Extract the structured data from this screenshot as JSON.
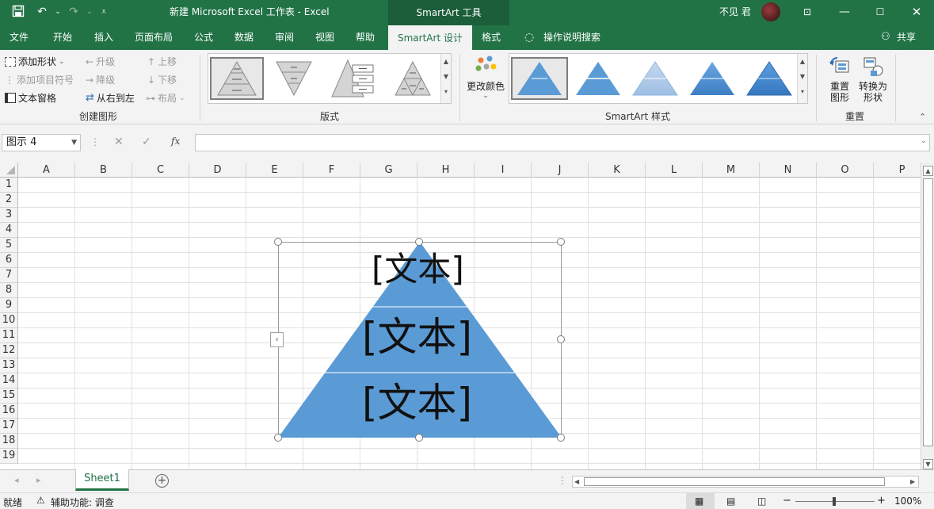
{
  "titlebar": {
    "doc_title": "新建 Microsoft Excel 工作表  -  Excel",
    "context_title": "SmartArt 工具",
    "user": "不见 君",
    "qat_icons": [
      "save-icon",
      "undo-icon",
      "redo-icon",
      "customize-qat-icon"
    ],
    "window_icons": [
      "ribbon-display-icon",
      "minimize-icon",
      "maximize-icon",
      "close-icon"
    ]
  },
  "tabs": [
    {
      "label": "文件"
    },
    {
      "label": "开始"
    },
    {
      "label": "插入"
    },
    {
      "label": "页面布局"
    },
    {
      "label": "公式"
    },
    {
      "label": "数据"
    },
    {
      "label": "审阅"
    },
    {
      "label": "视图"
    },
    {
      "label": "帮助"
    },
    {
      "label": "SmartArt 设计",
      "active": true
    },
    {
      "label": "格式"
    }
  ],
  "tell_me": "操作说明搜索",
  "share": "共享",
  "ribbon": {
    "create": {
      "add_shape": "添加形状",
      "add_bullet": "添加项目符号",
      "text_pane": "文本窗格",
      "promote": "升级",
      "demote": "降级",
      "right_to_left": "从右到左",
      "move_up": "上移",
      "move_down": "下移",
      "layout": "布局",
      "group_label": "创建图形"
    },
    "layouts": {
      "group_label": "版式"
    },
    "styles": {
      "change_colors": "更改颜色",
      "group_label": "SmartArt 样式"
    },
    "reset": {
      "reset_graphic": "重置\n图形",
      "convert": "转换为\n形状",
      "group_label": "重置"
    }
  },
  "formula_bar": {
    "name_box": "图示 4",
    "fx": "fx",
    "value": ""
  },
  "columns": [
    "A",
    "B",
    "C",
    "D",
    "E",
    "F",
    "G",
    "H",
    "I",
    "J",
    "K",
    "L",
    "M",
    "N",
    "O",
    "P"
  ],
  "rows": [
    "1",
    "2",
    "3",
    "4",
    "5",
    "6",
    "7",
    "8",
    "9",
    "10",
    "11",
    "12",
    "13",
    "14",
    "15",
    "16",
    "17",
    "18",
    "19"
  ],
  "smartart": {
    "type": "pyramid",
    "fill": "#5b9bd5",
    "levels": [
      "[文本]",
      "[文本]",
      "[文本]"
    ]
  },
  "sheet": {
    "tab": "Sheet1"
  },
  "status": {
    "ready": "就绪",
    "accessibility": "辅助功能: 调查",
    "zoom": "100%"
  },
  "colors": {
    "accent": "#217346",
    "pyramid": "#5b9bd5"
  }
}
